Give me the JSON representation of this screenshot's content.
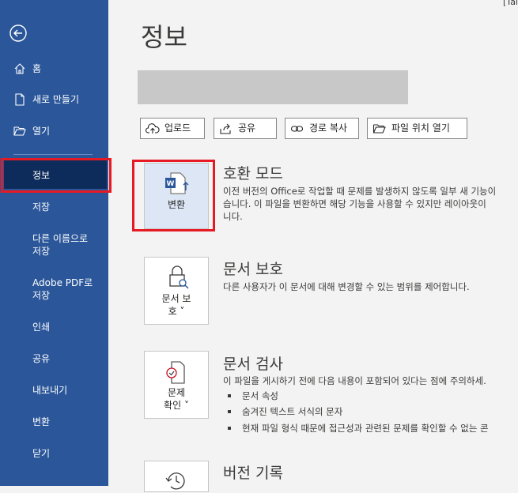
{
  "sidebar": {
    "items": [
      {
        "label": "홈",
        "icon": "home-icon"
      },
      {
        "label": "새로 만들기",
        "icon": "new-document-icon"
      },
      {
        "label": "열기",
        "icon": "open-folder-icon"
      },
      {
        "label": "정보",
        "active": true
      },
      {
        "label": "저장"
      },
      {
        "label": "다른 이름으로\n저장"
      },
      {
        "label": "Adobe PDF로\n저장"
      },
      {
        "label": "인쇄"
      },
      {
        "label": "공유"
      },
      {
        "label": "내보내기"
      },
      {
        "label": "변환"
      },
      {
        "label": "닫기"
      }
    ]
  },
  "corner_text": "[Tai",
  "main": {
    "title": "정보",
    "actions": [
      {
        "label": "업로드",
        "icon": "upload-icon"
      },
      {
        "label": "공유",
        "icon": "share-icon"
      },
      {
        "label": "경로 복사",
        "icon": "link-icon"
      },
      {
        "label": "파일 위치 열기",
        "icon": "folder-icon"
      }
    ],
    "sections": [
      {
        "button_label": "변환",
        "icon": "word-convert-icon",
        "heading": "호환 모드",
        "desc": [
          "이전 버전의 Office로 작업할 때 문제를 발생하지 않도록 일부 새 기능이",
          "습니다. 이 파일을 변환하면 해당 기능을 사용할 수 있지만 레이아웃이",
          "니다."
        ]
      },
      {
        "button_label": "문서 보\n호 ˅",
        "icon": "lock-icon",
        "heading": "문서 보호",
        "desc": [
          "다른 사용자가 이 문서에 대해 변경할 수 있는 범위를 제어합니다."
        ]
      },
      {
        "button_label": "문제\n확인 ˅",
        "icon": "inspect-document-icon",
        "heading": "문서 검사",
        "desc": [
          "이 파일을 게시하기 전에 다음 내용이 포함되어 있다는 점에 주의하세."
        ],
        "bullets": [
          "문서 속성",
          "숨겨진 텍스트 서식의 문자",
          "현재 파일 형식 때문에 접근성과 관련된 문제를 확인할 수 없는 콘"
        ]
      },
      {
        "icon": "version-history-icon",
        "heading": "버전 기록"
      }
    ]
  },
  "colors": {
    "sidebar": "#2b579a",
    "active": "#0e2c5b",
    "highlight": "#e51a24"
  }
}
